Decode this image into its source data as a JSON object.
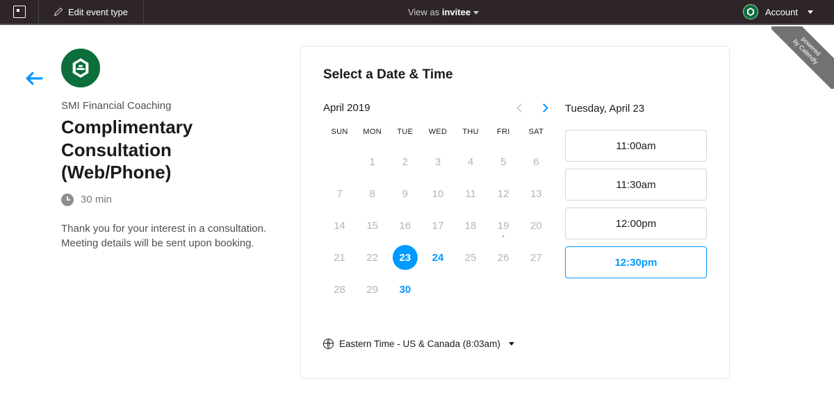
{
  "topbar": {
    "edit_label": "Edit event type",
    "view_as_prefix": "View as ",
    "view_as_role": "invitee",
    "account_label": "Account"
  },
  "ribbon": {
    "line1": "powered",
    "line2": "by Calendly"
  },
  "host": {
    "name": "SMI Financial Coaching"
  },
  "event": {
    "title": "Complimentary Consultation (Web/Phone)",
    "duration": "30 min",
    "description": "Thank you for your interest in a consultation. Meeting details will be sent upon booking."
  },
  "scheduler": {
    "title": "Select a Date & Time",
    "month": "April 2019",
    "dow": [
      "SUN",
      "MON",
      "TUE",
      "WED",
      "THU",
      "FRI",
      "SAT"
    ],
    "weeks": [
      [
        {
          "d": ""
        },
        {
          "d": "1"
        },
        {
          "d": "2"
        },
        {
          "d": "3"
        },
        {
          "d": "4"
        },
        {
          "d": "5"
        },
        {
          "d": "6"
        }
      ],
      [
        {
          "d": "7"
        },
        {
          "d": "8"
        },
        {
          "d": "9"
        },
        {
          "d": "10"
        },
        {
          "d": "11"
        },
        {
          "d": "12"
        },
        {
          "d": "13"
        }
      ],
      [
        {
          "d": "14"
        },
        {
          "d": "15"
        },
        {
          "d": "16"
        },
        {
          "d": "17"
        },
        {
          "d": "18"
        },
        {
          "d": "19",
          "dot": true
        },
        {
          "d": "20"
        }
      ],
      [
        {
          "d": "21"
        },
        {
          "d": "22"
        },
        {
          "d": "23",
          "selected": true,
          "avail": true
        },
        {
          "d": "24",
          "avail": true
        },
        {
          "d": "25"
        },
        {
          "d": "26"
        },
        {
          "d": "27"
        }
      ],
      [
        {
          "d": "28"
        },
        {
          "d": "29"
        },
        {
          "d": "30",
          "avail": true
        },
        {
          "d": ""
        },
        {
          "d": ""
        },
        {
          "d": ""
        },
        {
          "d": ""
        }
      ]
    ],
    "timezone": "Eastern Time - US & Canada (8:03am)",
    "selected_date_label": "Tuesday, April 23",
    "slots": [
      {
        "time": "11:00am",
        "selected": false
      },
      {
        "time": "11:30am",
        "selected": false
      },
      {
        "time": "12:00pm",
        "selected": false
      },
      {
        "time": "12:30pm",
        "selected": true
      }
    ]
  }
}
